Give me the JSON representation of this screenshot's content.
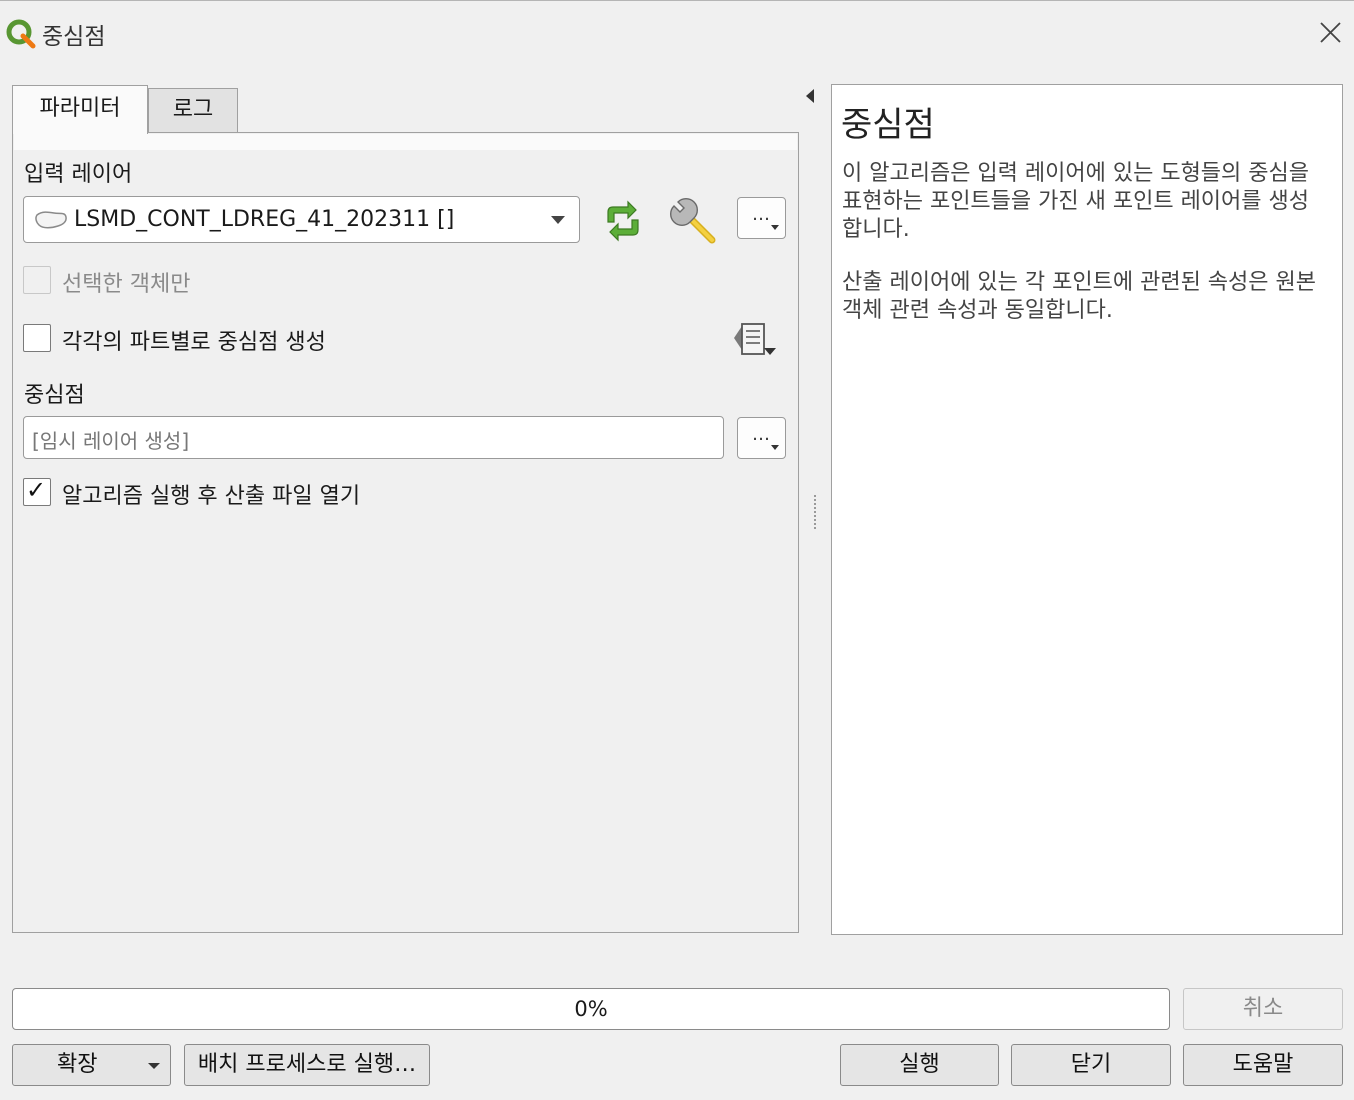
{
  "window": {
    "title": "중심점",
    "close_icon": "close-icon",
    "app_icon": "qgis-logo-icon"
  },
  "tabs": [
    {
      "label": "파라미터",
      "active": true
    },
    {
      "label": "로그",
      "active": false
    }
  ],
  "parameters": {
    "input_layer_label": "입력 레이어",
    "input_layer_value": "LSMD_CONT_LDREG_41_202311 []",
    "layer_icon": "polygon-layer-icon",
    "iterate_icon": "iterate-refresh-icon",
    "settings_icon": "wrench-icon",
    "dots_label": "…",
    "selected_only_label": "선택한 객체만",
    "selected_only_checked": false,
    "selected_only_enabled": false,
    "per_part_label": "각각의 파트별로 중심점 생성",
    "per_part_checked": false,
    "data_defined_icon": "data-defined-override-icon",
    "output_label": "중심점",
    "output_placeholder": "[임시 레이어 생성]",
    "open_after_label": "알고리즘 실행 후 산출 파일 열기",
    "open_after_checked": true
  },
  "help": {
    "title": "중심점",
    "paragraph1": "이 알고리즘은 입력 레이어에 있는 도형들의 중심을 표현하는 포인트들을 가진 새 포인트 레이어를 생성합니다.",
    "paragraph2": "산출 레이어에 있는 각 포인트에 관련된 속성은 원본 객체 관련 속성과 동일합니다."
  },
  "progress": {
    "text": "0%",
    "value": 0
  },
  "buttons": {
    "cancel": "취소",
    "advanced": "확장",
    "batch": "배치 프로세스로 실행…",
    "run": "실행",
    "close": "닫기",
    "help": "도움말"
  },
  "colors": {
    "iterate_green": "#4a9a2a",
    "window_bg": "#f0f0f0"
  }
}
